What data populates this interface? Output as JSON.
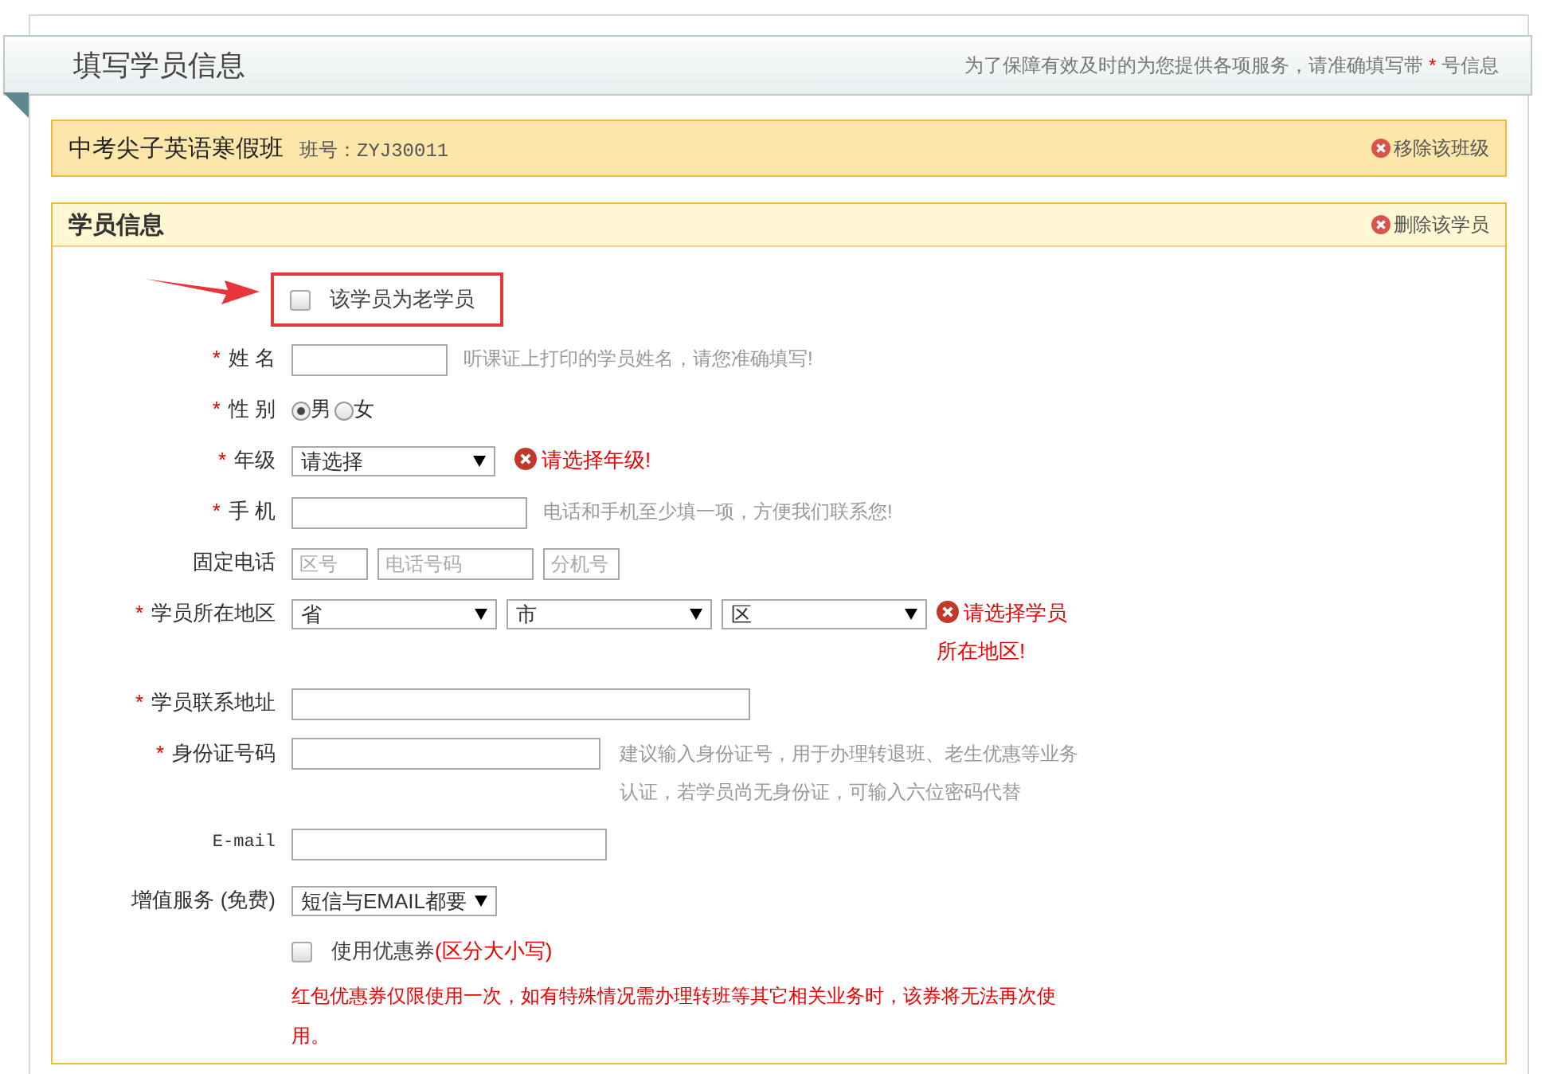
{
  "header": {
    "title": "填写学员信息",
    "notice_before": "为了保障有效及时的为您提供各项服务，请准确填写带",
    "notice_star": "*",
    "notice_after": "号信息"
  },
  "class_bar": {
    "name": "中考尖子英语寒假班",
    "code": "班号：ZYJ30011",
    "remove": "移除该班级"
  },
  "student_panel": {
    "title": "学员信息",
    "delete": "删除该学员",
    "old_student": {
      "label": "该学员为老学员",
      "checked": false
    },
    "fields": [
      {
        "kind": "name",
        "label": "姓 名",
        "required": true,
        "hint": "听课证上打印的学员姓名，请您准确填写!"
      },
      {
        "kind": "radio",
        "label": "性 别",
        "required": true,
        "options": [
          {
            "label": "男",
            "selected": true
          },
          {
            "label": "女",
            "selected": false
          }
        ]
      },
      {
        "kind": "select",
        "label": "年级",
        "required": true,
        "value": "请选择",
        "error": "请选择年级!"
      },
      {
        "kind": "mobile",
        "label": "手 机",
        "required": true,
        "hint": "电话和手机至少填一项，方便我们联系您!"
      },
      {
        "kind": "phone",
        "label": "固定电话",
        "required": false,
        "placeholders": [
          "区号",
          "电话号码",
          "分机号"
        ]
      },
      {
        "kind": "region",
        "label": "学员所在地区",
        "required": true,
        "selects": [
          "省",
          "市",
          "区"
        ],
        "error": "请选择学员所在地区!"
      },
      {
        "kind": "address",
        "label": "学员联系地址",
        "required": true
      },
      {
        "kind": "idcard",
        "label": "身份证号码",
        "required": true,
        "hint": "建议输入身份证号，用于办理转退班、老生优惠等业务认证，若学员尚无身份证，可输入六位密码代替"
      },
      {
        "kind": "email",
        "label": "E-mail",
        "required": false
      },
      {
        "kind": "service",
        "label": "增值服务 (免费)",
        "required": false,
        "value": "短信与EMAIL都要"
      },
      {
        "kind": "coupon",
        "label": "使用优惠券",
        "note": "(区分大小写)",
        "checked": false,
        "warning": "红包优惠券仅限使用一次，如有特殊情况需办理转班等其它相关业务时，该券将无法再次使用。"
      }
    ]
  }
}
